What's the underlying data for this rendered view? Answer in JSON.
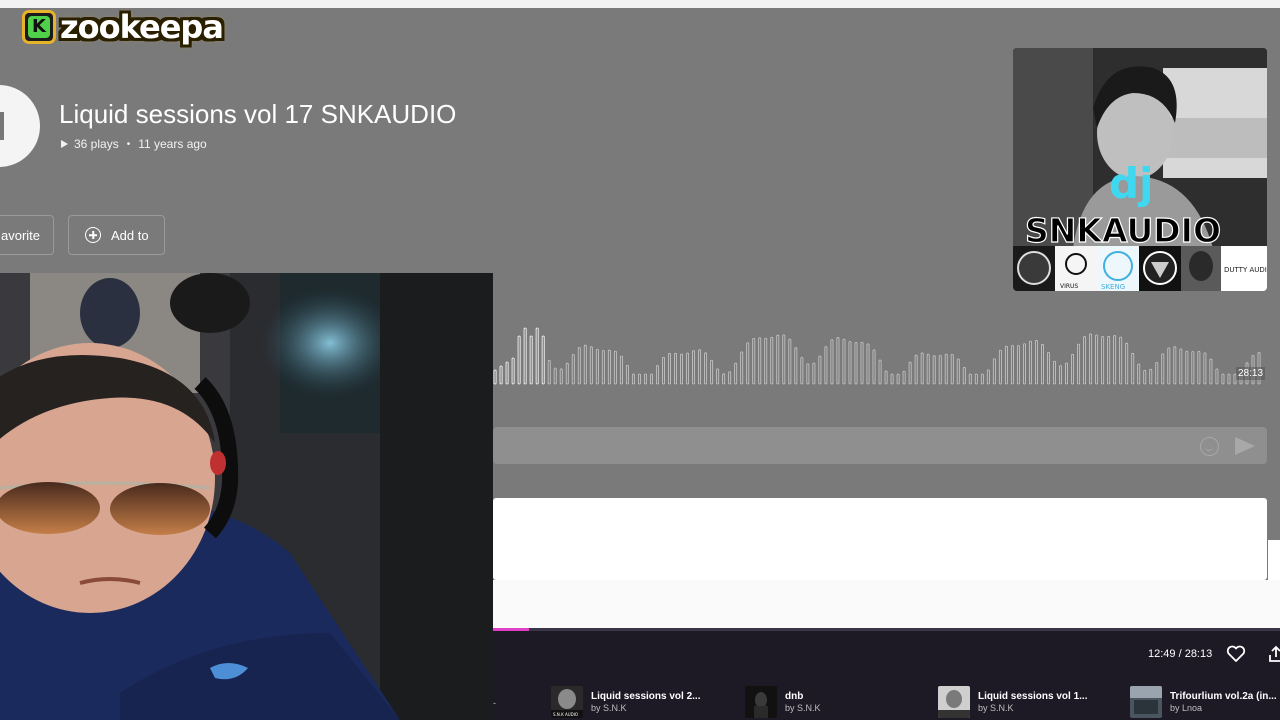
{
  "overlay": {
    "logo_letter": "K",
    "logo_text": "zookeepa"
  },
  "track": {
    "title": "Liquid sessions vol 17 SNKAUDIO",
    "plays": "36 plays",
    "age": "11 years ago",
    "duration": "28:13"
  },
  "actions": {
    "favorite_label": "avorite",
    "add_label": "Add to"
  },
  "cover": {
    "text_dj": "dj",
    "text_name": "SNKAUDIO",
    "logo_texts": [
      "VIRUS",
      "SKENG",
      "DUTTY AUDIO"
    ]
  },
  "player": {
    "time": "12:49 / 28:13",
    "progress": 0.0454,
    "queue": [
      {
        "title": "Liquid sessions vol 2...",
        "artist": "by S.N.K",
        "thumb_text": "S.N.K AUDIO"
      },
      {
        "title": "dnb",
        "artist": "by S.N.K",
        "thumb_text": ""
      },
      {
        "title": "Liquid sessions vol 1...",
        "artist": "by S.N.K",
        "thumb_text": ""
      },
      {
        "title": "Trifourlium vol.2a (in...",
        "artist": "by Lnoa",
        "thumb_text": ""
      }
    ]
  },
  "colors": {
    "page_bg": "#7a7a7a",
    "player_bg": "#1d1a26",
    "progress": "#e040c8",
    "cover_accent": "#3fd8f0",
    "logo_gold": "#e6b32a",
    "logo_green": "#4fd14a"
  }
}
